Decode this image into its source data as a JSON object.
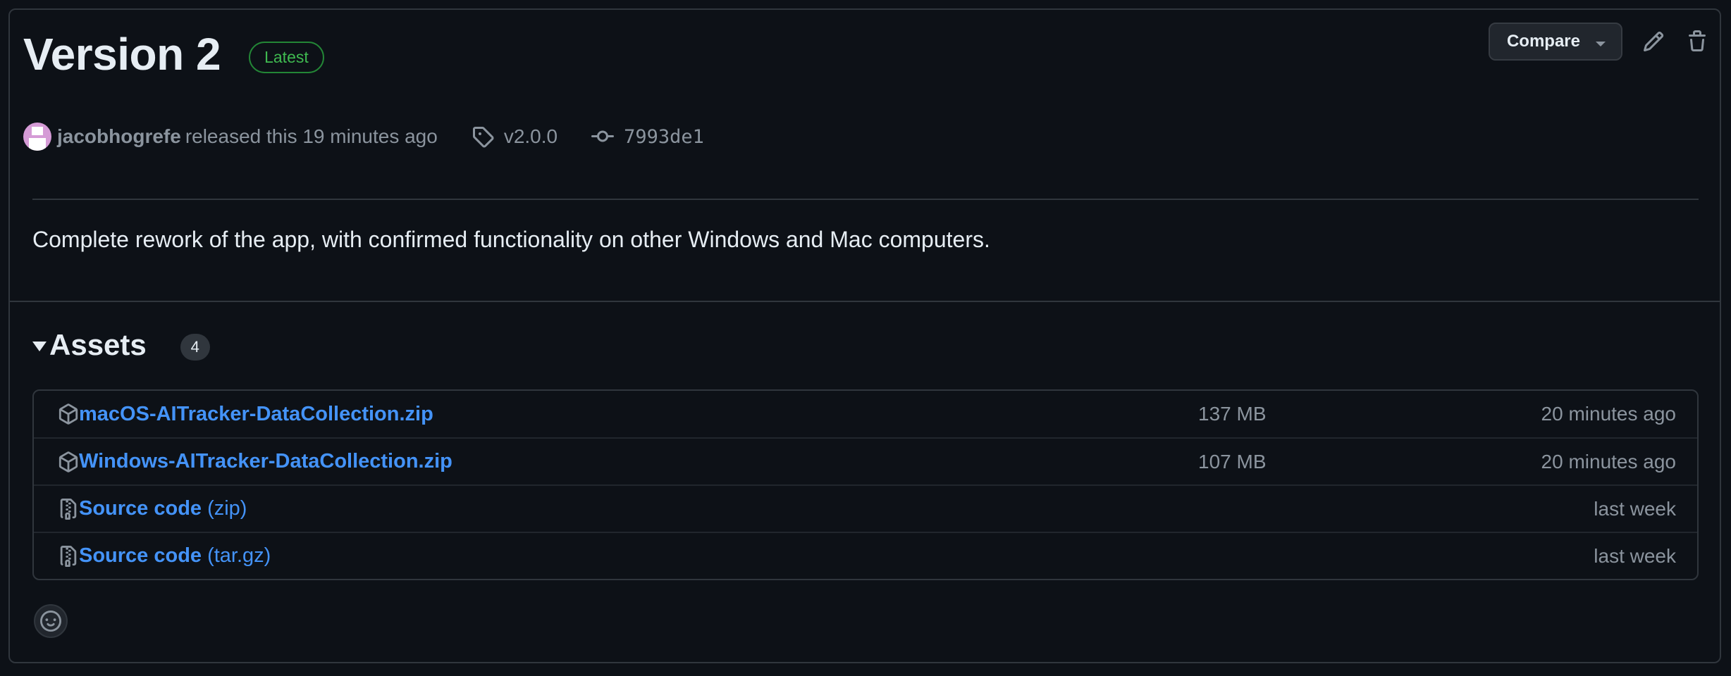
{
  "release": {
    "title": "Version 2",
    "badge": "Latest",
    "author": "jacobhogrefe",
    "released_text": "released this 19 minutes ago",
    "tag": "v2.0.0",
    "commit": "7993de1",
    "description": "Complete rework of the app, with confirmed functionality on other Windows and Mac computers."
  },
  "actions": {
    "compare_label": "Compare",
    "edit_icon": "pencil-icon",
    "delete_icon": "trash-icon"
  },
  "assets": {
    "label": "Assets",
    "count": "4",
    "items": [
      {
        "icon": "package-icon",
        "name": "macOS-AITracker-DataCollection.zip",
        "suffix": "",
        "size": "137 MB",
        "time": "20 minutes ago"
      },
      {
        "icon": "package-icon",
        "name": "Windows-AITracker-DataCollection.zip",
        "suffix": "",
        "size": "107 MB",
        "time": "20 minutes ago"
      },
      {
        "icon": "file-zip-icon",
        "name": "Source code",
        "suffix": "(zip)",
        "size": "",
        "time": "last week"
      },
      {
        "icon": "file-zip-icon",
        "name": "Source code",
        "suffix": "(tar.gz)",
        "size": "",
        "time": "last week"
      }
    ]
  },
  "colors": {
    "background": "#0d1117",
    "border": "#30363d",
    "link": "#4493f8",
    "muted": "#8b949e",
    "latest_green": "#3fb950"
  }
}
